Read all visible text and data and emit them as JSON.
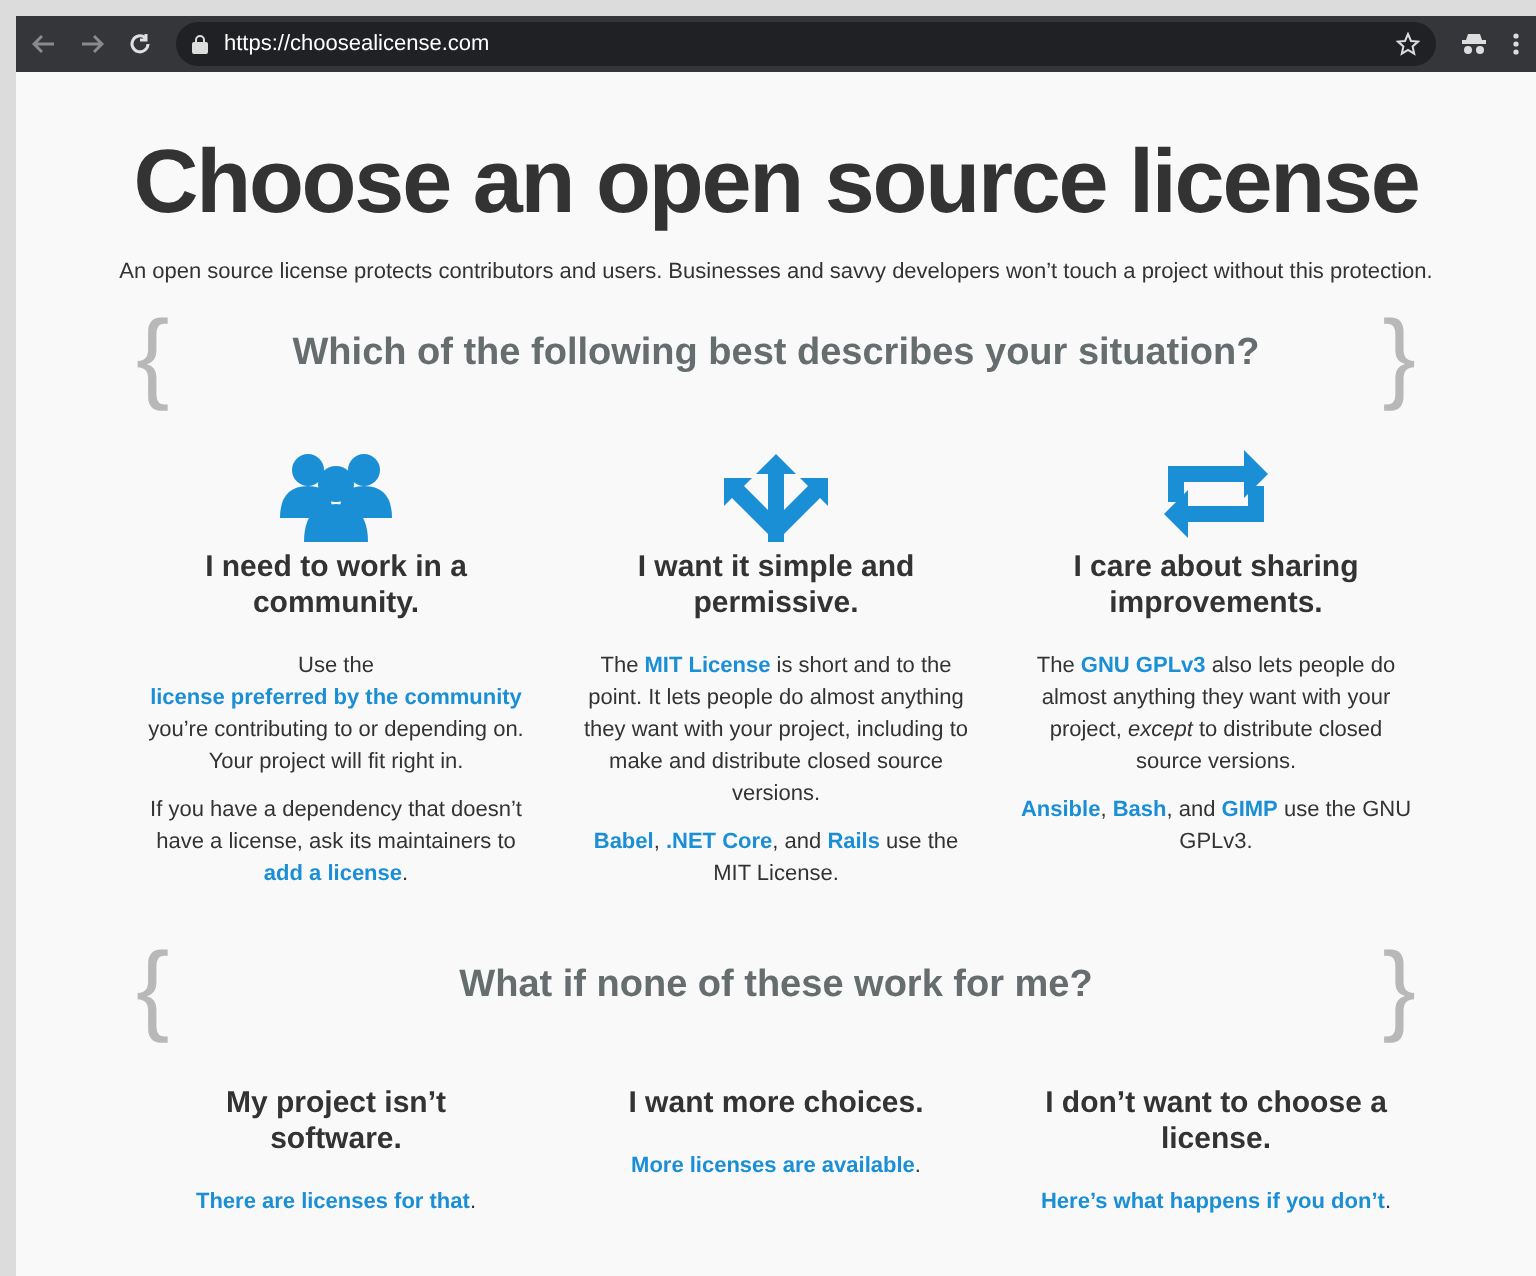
{
  "browser": {
    "url": "https://choosealicense.com"
  },
  "title": "Choose an open source license",
  "intro": "An open source license protects contributors and users. Businesses and savvy developers won’t touch a project without this protection.",
  "sections": [
    {
      "open_brace": "{",
      "heading": "Which of the following best describes your situation?",
      "close_brace": "}",
      "columns": [
        {
          "heading": "I need to work in a community.",
          "paragraphs": [
            [
              {
                "kind": "text",
                "text": "Use the "
              },
              {
                "kind": "link",
                "text": "license preferred by the "
              },
              {
                "kind": "link",
                "text": "community"
              },
              {
                "kind": "text",
                "text": " you’re contributing to or depending on. Your project will fit right in."
              }
            ],
            [
              {
                "kind": "text",
                "text": "If you have a dependency that doesn’t have a license, ask its maintainers to "
              },
              {
                "kind": "link",
                "text": "add a license"
              },
              {
                "kind": "text",
                "text": "."
              }
            ]
          ]
        },
        {
          "heading": "I want it simple and permissive.",
          "paragraphs": [
            [
              {
                "kind": "text",
                "text": "The "
              },
              {
                "kind": "link",
                "text": "MIT License"
              },
              {
                "kind": "text",
                "text": " is short and to the point. It lets people do almost anything they want with your project, including to make and distribute closed source versions."
              }
            ],
            [
              {
                "kind": "link",
                "text": "Babel"
              },
              {
                "kind": "text",
                "text": ", "
              },
              {
                "kind": "link",
                "text": ".NET Core"
              },
              {
                "kind": "text",
                "text": ", and "
              },
              {
                "kind": "link",
                "text": "Rails"
              },
              {
                "kind": "text",
                "text": " use the MIT License."
              }
            ]
          ]
        },
        {
          "heading": "I care about sharing improvements.",
          "paragraphs": [
            [
              {
                "kind": "text",
                "text": "The "
              },
              {
                "kind": "link",
                "text": "GNU GPLv3"
              },
              {
                "kind": "text",
                "text": " also lets people do almost anything they want with your project, "
              },
              {
                "kind": "em",
                "text": "except"
              },
              {
                "kind": "text",
                "text": " to distribute closed source versions."
              }
            ],
            [
              {
                "kind": "link",
                "text": "Ansible"
              },
              {
                "kind": "text",
                "text": ", "
              },
              {
                "kind": "link",
                "text": "Bash"
              },
              {
                "kind": "text",
                "text": ", and "
              },
              {
                "kind": "link",
                "text": "GIMP"
              },
              {
                "kind": "text",
                "text": " use the GNU GPLv3."
              }
            ]
          ]
        }
      ]
    },
    {
      "open_brace": "{",
      "heading": "What if none of these work for me?",
      "close_brace": "}",
      "columns": [
        {
          "heading": "My project isn’t software.",
          "paragraphs": [
            [
              {
                "kind": "link",
                "text": "There are licenses for that"
              },
              {
                "kind": "text",
                "text": "."
              }
            ]
          ]
        },
        {
          "heading": "I want more choices.",
          "paragraphs": [
            [
              {
                "kind": "link",
                "text": "More licenses are available"
              },
              {
                "kind": "text",
                "text": "."
              }
            ]
          ]
        },
        {
          "heading": "I don’t want to choose a license.",
          "paragraphs": [
            [
              {
                "kind": "link",
                "text": "Here’s what happens if you don’t"
              },
              {
                "kind": "text",
                "text": "."
              }
            ]
          ]
        }
      ]
    }
  ]
}
